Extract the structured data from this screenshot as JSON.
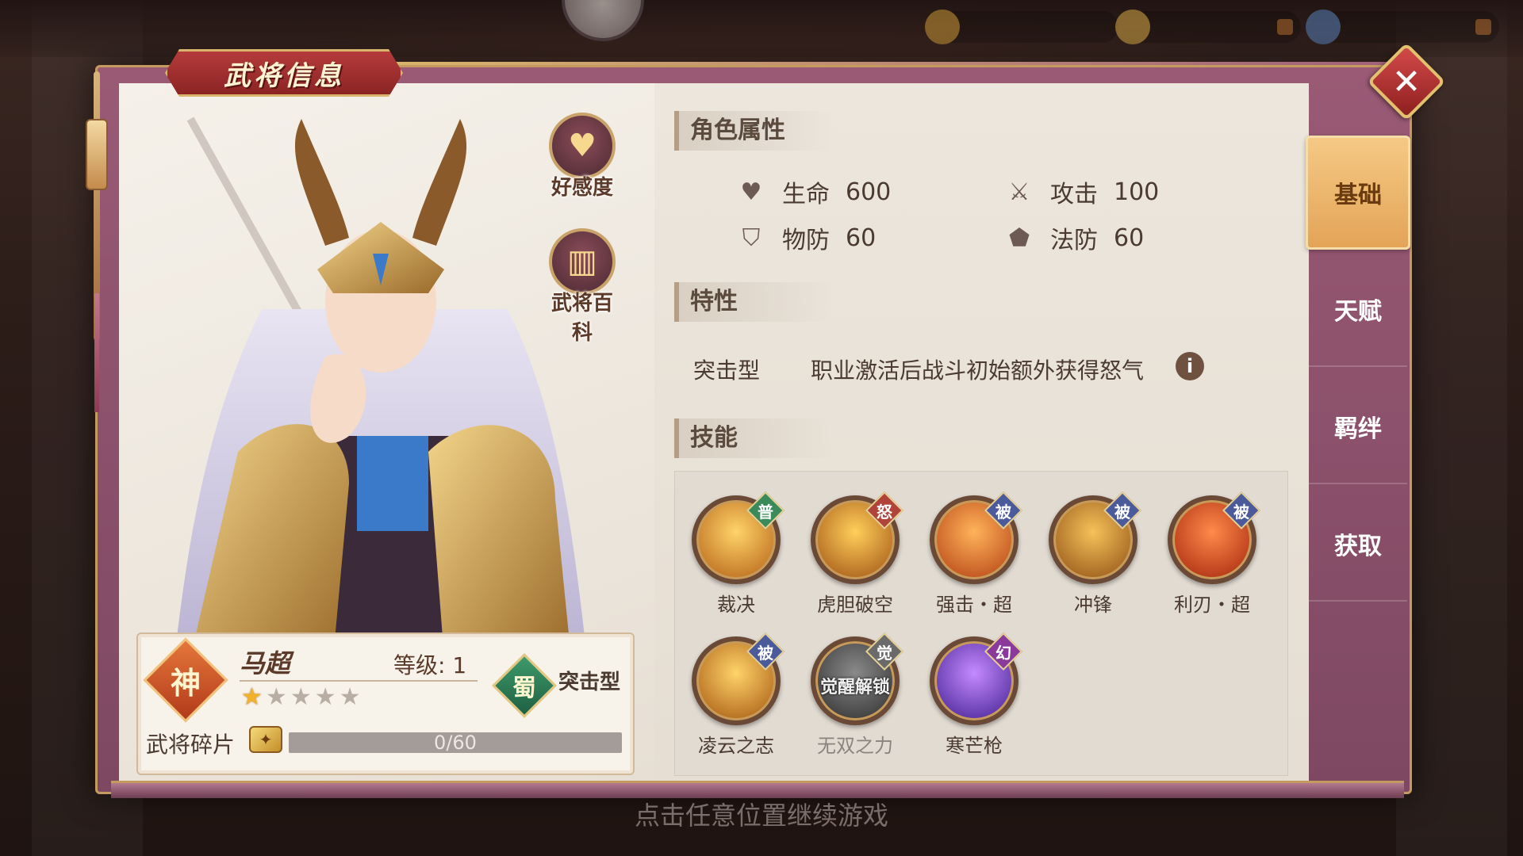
{
  "window": {
    "title": "武将信息"
  },
  "top_resources": [
    {
      "icon": "gold-coin-icon",
      "color": "#d8a23a"
    },
    {
      "icon": "gem-icon",
      "color": "#e6b64a"
    },
    {
      "icon": "stamina-icon",
      "color": "#5a8ac8"
    }
  ],
  "side_buttons": {
    "affinity": {
      "label": "好感度",
      "icon": "heart-icon"
    },
    "encyclopedia": {
      "label": "武将百科",
      "icon": "book-icon"
    }
  },
  "hero": {
    "name": "马超",
    "rarity_badge": "神",
    "level_text": "等级: 1",
    "stars_filled": 1,
    "stars_total": 5,
    "faction": "蜀",
    "type": "突击型",
    "fragments_label": "武将碎片",
    "fragments_text": "0/60",
    "fragments_current": 0,
    "fragments_total": 60
  },
  "sections": {
    "attributes_title": "角色属性",
    "traits_title": "特性",
    "skills_title": "技能"
  },
  "attributes": [
    {
      "label": "生命",
      "value": "600",
      "icon": "heart-icon"
    },
    {
      "label": "攻击",
      "value": "100",
      "icon": "sword-icon"
    },
    {
      "label": "物防",
      "value": "60",
      "icon": "shield-icon"
    },
    {
      "label": "法防",
      "value": "60",
      "icon": "magic-shield-icon"
    }
  ],
  "trait": {
    "name": "突击型",
    "description": "职业激活后战斗初始额外获得怒气"
  },
  "skills": [
    {
      "name": "裁决",
      "tag": "普",
      "tag_color": "#3a8a5a"
    },
    {
      "name": "虎胆破空",
      "tag": "怒",
      "tag_color": "#b0443a"
    },
    {
      "name": "强击・超",
      "tag": "被",
      "tag_color": "#4a5a9a"
    },
    {
      "name": "冲锋",
      "tag": "被",
      "tag_color": "#4a5a9a"
    },
    {
      "name": "利刃・超",
      "tag": "被",
      "tag_color": "#4a5a9a"
    },
    {
      "name": "凌云之志",
      "tag": "被",
      "tag_color": "#4a5a9a"
    },
    {
      "name": "无双之力",
      "tag": "觉",
      "tag_color": "#6a6a6a",
      "locked_text": "觉醒解锁"
    },
    {
      "name": "寒芒枪",
      "tag": "幻",
      "tag_color": "#8a3a9a"
    }
  ],
  "tabs": [
    {
      "label": "基础",
      "active": true
    },
    {
      "label": "天赋",
      "active": false
    },
    {
      "label": "羁绊",
      "active": false
    },
    {
      "label": "获取",
      "active": false
    }
  ],
  "close_label": "✕",
  "bottom_hint": "点击任意位置继续游戏"
}
